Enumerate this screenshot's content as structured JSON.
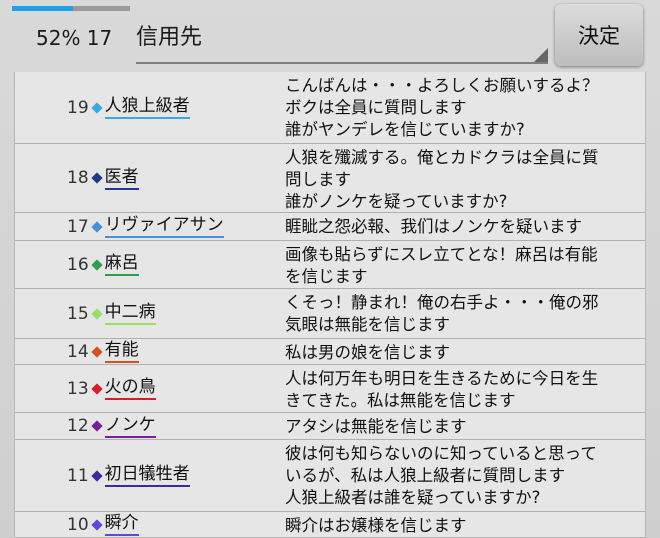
{
  "header": {
    "progress_percent": 52,
    "status": "52% 17",
    "select_value": "信用先",
    "decide_label": "決定",
    "progress_color": "#1ea0e6"
  },
  "rows": [
    {
      "num": "19",
      "name": "人狼上級者",
      "color": "#3aa9e0",
      "msg": "こんばんは・・・よろしくお願いするよ？\nボクは全員に質問します\n誰がヤンデレを信じていますか?"
    },
    {
      "num": "18",
      "name": "医者",
      "color": "#1f3a8a",
      "msg": "人狼を殲滅する。俺とカドクラは全員に質\n問します\n誰がノンケを疑っていますか?"
    },
    {
      "num": "17",
      "name": "リヴァイアサン",
      "color": "#4a90d9",
      "msg": "睚眦之怨必報、我们はノンケを疑います"
    },
    {
      "num": "16",
      "name": "麻呂",
      "color": "#2fa04a",
      "msg": "画像も貼らずにスレ立てとな！麻呂は有能\nを信じます"
    },
    {
      "num": "15",
      "name": "中二病",
      "color": "#9be062",
      "msg": "くそっ！静まれ！俺の右手よ・・・俺の邪\n気眼は無能を信じます"
    },
    {
      "num": "14",
      "name": "有能",
      "color": "#d4531f",
      "msg": "私は男の娘を信じます"
    },
    {
      "num": "13",
      "name": "火の鳥",
      "color": "#d41f2d",
      "msg": "人は何万年も明日を生きるために今日を生\nきてきた。私は無能を信じます"
    },
    {
      "num": "12",
      "name": "ノンケ",
      "color": "#7a1f9a",
      "msg": "アタシは無能を信じます"
    },
    {
      "num": "11",
      "name": "初日犠牲者",
      "color": "#3b2a9a",
      "msg": "彼は何も知らないのに知っていると思って\nいるが、私は人狼上級者に質問します\n人狼上級者は誰を疑っていますか?"
    },
    {
      "num": "10",
      "name": "瞬介",
      "color": "#5b4ad6",
      "msg": "瞬介はお嬢様を信じます"
    }
  ]
}
